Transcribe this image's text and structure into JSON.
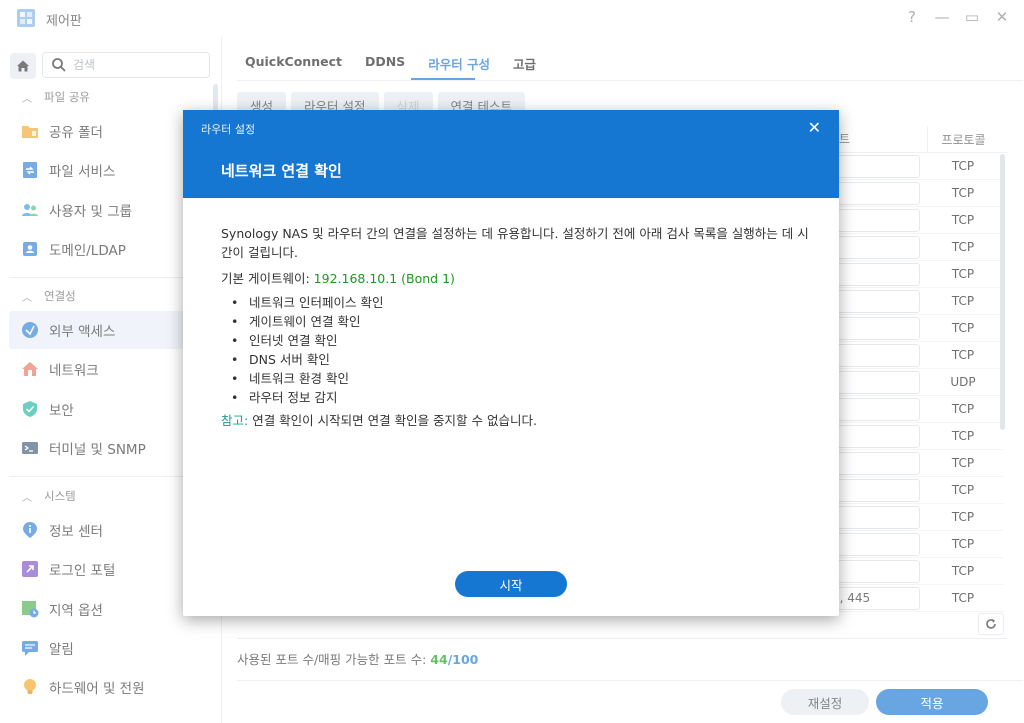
{
  "window": {
    "title": "제어판",
    "controls": [
      "?",
      "—",
      "▭",
      "✕"
    ]
  },
  "search": {
    "placeholder": "검색"
  },
  "sidebar": {
    "sections": [
      {
        "title": "파일 공유",
        "items": [
          "공유 폴더",
          "파일 서비스",
          "사용자 및 그룹",
          "도메인/LDAP"
        ]
      },
      {
        "title": "연결성",
        "items": [
          "외부 액세스",
          "네트워크",
          "보안",
          "터미널 및 SNMP"
        ]
      },
      {
        "title": "시스템",
        "items": [
          "정보 센터",
          "로그인 포털",
          "지역 옵션",
          "알림",
          "하드웨어 및 전원"
        ]
      }
    ],
    "active_item": "외부 액세스"
  },
  "tabs": [
    "QuickConnect",
    "DDNS",
    "라우터 구성",
    "고급"
  ],
  "active_tab": "라우터 구성",
  "toolbar": {
    "create": "생성",
    "router_settings": "라우터 설정",
    "delete": "삭제",
    "test": "연결 테스트"
  },
  "table": {
    "port_header_stub": "트",
    "protocol_header": "프로토콜",
    "rows": [
      {
        "port": "",
        "protocol": "TCP"
      },
      {
        "port": "",
        "protocol": "TCP"
      },
      {
        "port": "",
        "protocol": "TCP"
      },
      {
        "port": "",
        "protocol": "TCP"
      },
      {
        "port": "",
        "protocol": "TCP"
      },
      {
        "port": "",
        "protocol": "TCP"
      },
      {
        "port": "",
        "protocol": "TCP"
      },
      {
        "port": "",
        "protocol": "TCP"
      },
      {
        "port": "",
        "protocol": "UDP"
      },
      {
        "port": "",
        "protocol": "TCP"
      },
      {
        "port": "",
        "protocol": "TCP"
      },
      {
        "port": "",
        "protocol": "TCP"
      },
      {
        "port": "",
        "protocol": "TCP"
      },
      {
        "port": "",
        "protocol": "TCP"
      },
      {
        "port": "",
        "protocol": "TCP"
      },
      {
        "port": "",
        "protocol": "TCP"
      },
      {
        "port": "9, 445",
        "protocol": "TCP"
      }
    ]
  },
  "port_usage": {
    "label": "사용된 포트 수/매핑 가능한 포트 수:",
    "used": "44",
    "sep": "/",
    "total": "100"
  },
  "footer": {
    "reset": "재설정",
    "apply": "적용"
  },
  "modal": {
    "small_title": "라우터 설정",
    "title": "네트워크 연결 확인",
    "description": "Synology NAS 및 라우터 간의 연결을 설정하는 데 유용합니다. 설정하기 전에 아래 검사 목록을 실행하는 데 시간이 걸립니다.",
    "gateway_label": "기본 게이트웨이: ",
    "gateway_value": "192.168.10.1 (Bond 1)",
    "checks": [
      "네트워크 인터페이스 확인",
      "게이트웨이 연결 확인",
      "인터넷 연결 확인",
      "DNS 서버 확인",
      "네트워크 환경 확인",
      "라우터 정보 감지"
    ],
    "note_label": "참고:",
    "note_text": " 연결 확인이 시작되면 연결 확인을 중지할 수 없습니다.",
    "start": "시작",
    "close": "✕"
  },
  "colors": {
    "accent": "#1677d2",
    "success": "#1a9c1a",
    "note": "#1a9c9c"
  }
}
